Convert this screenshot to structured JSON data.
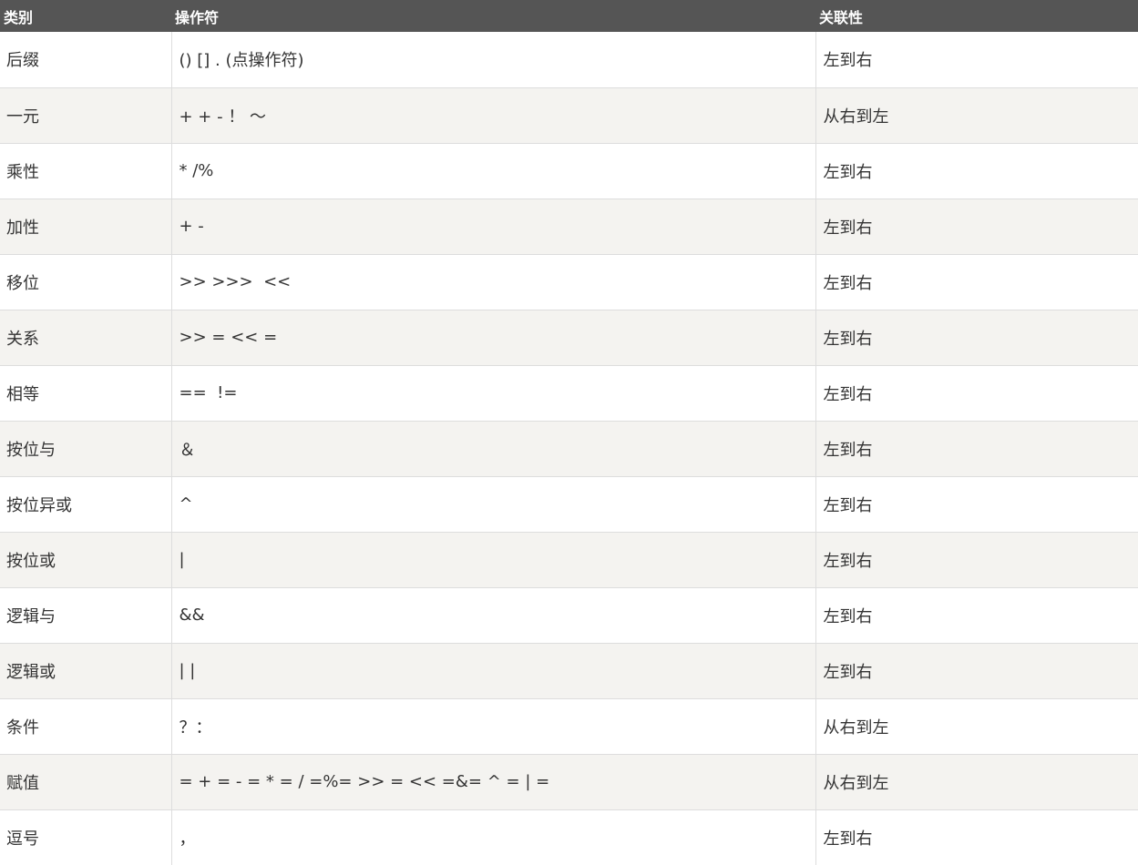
{
  "table": {
    "headers": [
      "类别",
      "操作符",
      "关联性"
    ],
    "rows": [
      {
        "category": "后缀",
        "operator": "() [] . (点操作符)",
        "associativity": "左到右"
      },
      {
        "category": "一元",
        "operator": "+ + - ！ 〜",
        "associativity": "从右到左"
      },
      {
        "category": "乘性",
        "operator": "* /%",
        "associativity": "左到右"
      },
      {
        "category": "加性",
        "operator": "+ -",
        "associativity": "左到右"
      },
      {
        "category": "移位",
        "operator": ">> >>>  <<",
        "associativity": "左到右"
      },
      {
        "category": "关系",
        "operator": ">> = << =",
        "associativity": "左到右"
      },
      {
        "category": "相等",
        "operator": "==  !=",
        "associativity": "左到右"
      },
      {
        "category": "按位与",
        "operator": "＆",
        "associativity": "左到右"
      },
      {
        "category": "按位异或",
        "operator": "^",
        "associativity": "左到右"
      },
      {
        "category": "按位或",
        "operator": "|",
        "associativity": "左到右"
      },
      {
        "category": "逻辑与",
        "operator": "&&",
        "associativity": "左到右"
      },
      {
        "category": "逻辑或",
        "operator": "| |",
        "associativity": "左到右"
      },
      {
        "category": "条件",
        "operator": "？：",
        "associativity": "从右到左"
      },
      {
        "category": "赋值",
        "operator": "= + = - = * = / =%= >> = << =&= ^ = | =",
        "associativity": "从右到左"
      },
      {
        "category": "逗号",
        "operator": "，",
        "associativity": "左到右"
      }
    ]
  }
}
